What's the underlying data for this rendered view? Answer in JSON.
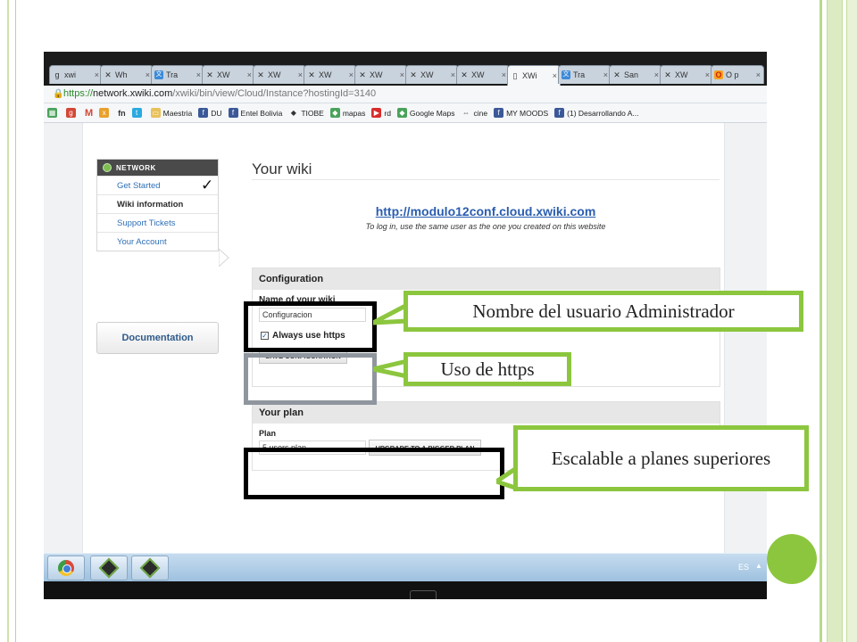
{
  "browser": {
    "tabs": [
      {
        "label": "xwi",
        "icon": "google-icon"
      },
      {
        "label": "Wh",
        "icon": "xwiki-icon"
      },
      {
        "label": "Tra",
        "icon": "translate-icon"
      },
      {
        "label": "XW",
        "icon": "xwiki-icon"
      },
      {
        "label": "XW",
        "icon": "xwiki-icon"
      },
      {
        "label": "XW",
        "icon": "xwiki-icon"
      },
      {
        "label": "XW",
        "icon": "xwiki-icon"
      },
      {
        "label": "XW",
        "icon": "xwiki-icon"
      },
      {
        "label": "XW",
        "icon": "xwiki-icon"
      },
      {
        "label": "XWi",
        "icon": "page-icon",
        "active": true
      },
      {
        "label": "Tra",
        "icon": "translate-icon"
      },
      {
        "label": "San",
        "icon": "xwiki-icon"
      },
      {
        "label": "XW",
        "icon": "xwiki-icon"
      },
      {
        "label": "O p",
        "icon": "opera-icon"
      }
    ],
    "url": {
      "scheme": "https://",
      "host": "network.xwiki.com",
      "path": "/xwiki/bin/view/Cloud/Instance?hostingId=3140"
    },
    "bookmarks": [
      {
        "label": "Maestria",
        "icon": "folder-icon"
      },
      {
        "label": "DU",
        "icon": "facebook-icon"
      },
      {
        "label": "Entel Bolivia",
        "icon": "facebook-icon"
      },
      {
        "label": "TIOBE",
        "icon": "diamond-icon"
      },
      {
        "label": "mapas",
        "icon": "maps-icon"
      },
      {
        "label": "rd",
        "icon": "youtube-icon"
      },
      {
        "label": "Google Maps",
        "icon": "maps-icon"
      },
      {
        "label": "cine",
        "icon": "link-icon"
      },
      {
        "label": "MY MOODS",
        "icon": "facebook-icon"
      },
      {
        "label": "(1) Desarrollando A...",
        "icon": "facebook-icon"
      }
    ]
  },
  "sidebar": {
    "header": "Network",
    "items": [
      {
        "label": "Get Started"
      },
      {
        "label": "Wiki information",
        "current": true
      },
      {
        "label": "Support Tickets"
      },
      {
        "label": "Your Account"
      }
    ],
    "documentation": "Documentation",
    "check_mark": "✓"
  },
  "main": {
    "title": "Your wiki",
    "wiki_url": "http://modulo12conf.cloud.xwiki.com",
    "login_note": "To log in, use the same user as the one you created on this website",
    "configuration": {
      "header": "Configuration",
      "name_label": "Name of your wiki",
      "name_value": "Configuracion",
      "https_label": "Always use https",
      "https_checked": true,
      "save_button": "SAVE CONFIGURATION"
    },
    "plan": {
      "header": "Your plan",
      "plan_label": "Plan",
      "plan_value": "5 users plan",
      "upgrade_button": "UPGRADE TO A BIGGER PLAN"
    }
  },
  "annotations": {
    "admin_user": "Nombre del usuario Administrador",
    "https": "Uso de https",
    "scalable": "Escalable a planes superiores"
  },
  "taskbar": {
    "lang": "ES"
  },
  "colors": {
    "accent_green": "#8cc63e",
    "link_blue": "#2a5db0"
  }
}
